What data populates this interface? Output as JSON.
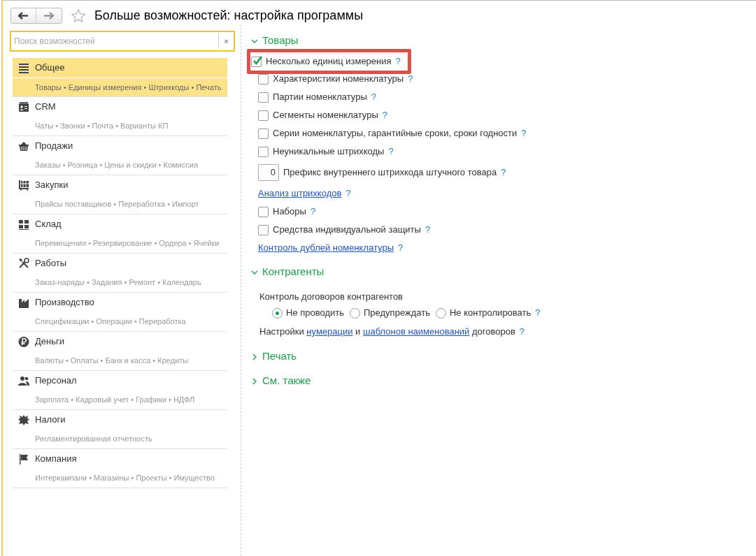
{
  "window": {
    "title": "Больше возможностей: настройка программы",
    "favorite": false
  },
  "search": {
    "placeholder": "Поиск возможностей",
    "clear": "×"
  },
  "sidebar": {
    "items": [
      {
        "title": "Общее",
        "subtitle": "Товары • Единицы измерения • Штрихкоды • Печать",
        "selected": true
      },
      {
        "title": "CRM",
        "subtitle": "Чаты • Звонки • Почта • Варианты КП",
        "selected": false
      },
      {
        "title": "Продажи",
        "subtitle": "Заказы • Розница • Цены и скидки • Комиссия",
        "selected": false
      },
      {
        "title": "Закупки",
        "subtitle": "Прайсы поставщиков • Переработка • Импорт",
        "selected": false
      },
      {
        "title": "Склад",
        "subtitle": "Перемещения • Резервирование • Ордера • Ячейки",
        "selected": false
      },
      {
        "title": "Работы",
        "subtitle": "Заказ-наряды • Задания • Ремонт • Календарь",
        "selected": false
      },
      {
        "title": "Производство",
        "subtitle": "Спецификации • Операции • Переработка",
        "selected": false
      },
      {
        "title": "Деньги",
        "subtitle": "Валюты • Оплаты • Банк и касса • Кредиты",
        "selected": false
      },
      {
        "title": "Персонал",
        "subtitle": "Зарплата • Кадровый учет • Графики • НДФЛ",
        "selected": false
      },
      {
        "title": "Налоги",
        "subtitle": "Регламентированная отчетность",
        "selected": false
      },
      {
        "title": "Компания",
        "subtitle": "Интеркампани • Магазины • Проекты • Имущество",
        "selected": false
      }
    ]
  },
  "sections": [
    {
      "title": "Товары",
      "expanded": true,
      "items": [
        {
          "kind": "checkbox",
          "label": "Несколько единиц измерения",
          "checked": true,
          "help": "?",
          "highlighted": true
        },
        {
          "kind": "checkbox",
          "label": "Характеристики номенклатуры",
          "checked": false,
          "help": "?",
          "highlighted": false
        },
        {
          "kind": "checkbox",
          "label": "Партии номенклатуры",
          "checked": false,
          "help": "?",
          "highlighted": false
        },
        {
          "kind": "checkbox",
          "label": "Сегменты номенклатуры",
          "checked": false,
          "help": "?",
          "highlighted": false
        },
        {
          "kind": "checkbox",
          "label": "Серии номенклатуры, гарантийные сроки, сроки годности",
          "checked": false,
          "help": "?",
          "highlighted": false
        },
        {
          "kind": "checkbox",
          "label": "Неуникальные штрихкоды",
          "checked": false,
          "help": "?",
          "highlighted": false
        },
        {
          "kind": "number",
          "value": "0",
          "label": "Префикс внутреннего штрихкода штучного товара",
          "help": "?",
          "highlighted": false
        },
        {
          "kind": "link",
          "label": "Анализ штрихкодов",
          "help": "?",
          "highlighted": false
        },
        {
          "kind": "checkbox",
          "label": "Наборы",
          "checked": false,
          "help": "?",
          "highlighted": false
        },
        {
          "kind": "checkbox",
          "label": "Средства индивидуальной защиты",
          "checked": false,
          "help": "?",
          "highlighted": false
        },
        {
          "kind": "link",
          "label": "Контроль дублей номенклатуры",
          "help": "?",
          "highlighted": false
        }
      ]
    },
    {
      "title": "Контрагенты",
      "expanded": true,
      "items": [
        {
          "kind": "label",
          "label": "Контроль договоров контрагентов"
        },
        {
          "kind": "radio",
          "options": [
            {
              "label": "Не проводить",
              "selected": true
            },
            {
              "label": "Предупреждать",
              "selected": false
            },
            {
              "label": "Не контролировать",
              "selected": false
            }
          ],
          "help": "?"
        },
        {
          "kind": "sentence",
          "parts": [
            {
              "text": "Настройки ",
              "link": false
            },
            {
              "text": "нумерации",
              "link": true
            },
            {
              "text": " и ",
              "link": false
            },
            {
              "text": "шаблонов наименований",
              "link": true
            },
            {
              "text": " договоров",
              "link": false
            }
          ],
          "help": "?"
        }
      ]
    },
    {
      "title": "Печать",
      "expanded": false
    },
    {
      "title": "См. также",
      "expanded": false
    }
  ]
}
